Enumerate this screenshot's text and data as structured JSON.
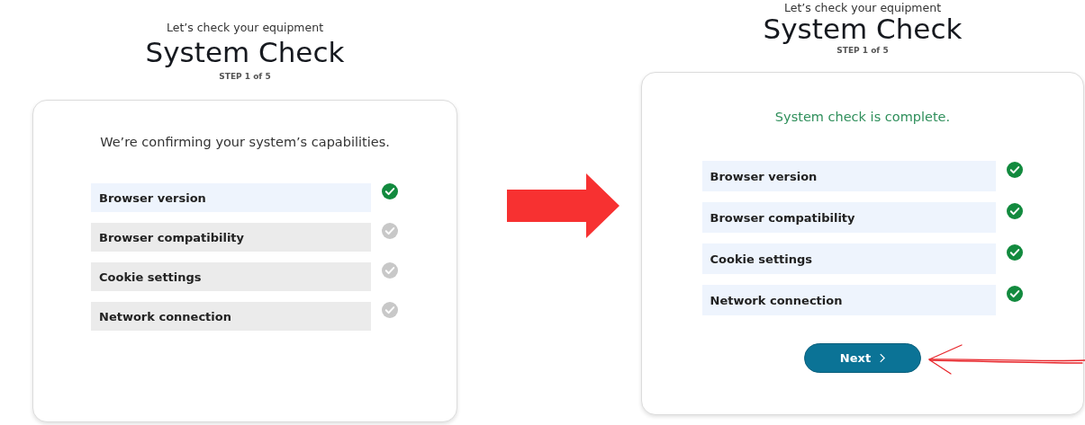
{
  "panels": [
    {
      "subtitle": "Let’s check your equipment",
      "title": "System Check",
      "step": "STEP 1 of 5",
      "message": "We’re confirming your system’s capabilities.",
      "complete": false,
      "checks": [
        {
          "label": "Browser version",
          "checked": true
        },
        {
          "label": "Browser compatibility",
          "checked": false
        },
        {
          "label": "Cookie settings",
          "checked": false
        },
        {
          "label": "Network connection",
          "checked": false
        }
      ]
    },
    {
      "subtitle": "Let’s check your equipment",
      "title": "System Check",
      "step": "STEP 1 of 5",
      "message": "System check is complete.",
      "complete": true,
      "checks": [
        {
          "label": "Browser version",
          "checked": true
        },
        {
          "label": "Browser compatibility",
          "checked": true
        },
        {
          "label": "Cookie settings",
          "checked": true
        },
        {
          "label": "Network connection",
          "checked": true
        }
      ],
      "button": {
        "label": "Next"
      }
    }
  ]
}
